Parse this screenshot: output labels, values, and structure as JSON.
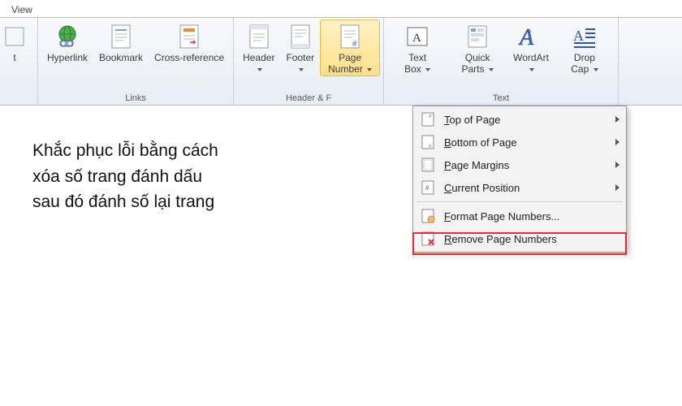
{
  "tab": "View",
  "ribbon": {
    "cut_tail": "t",
    "hyperlink": "Hyperlink",
    "bookmark": "Bookmark",
    "crossref": "Cross-reference",
    "links_group": "Links",
    "header": "Header",
    "footer": "Footer",
    "page_number": "Page\nNumber",
    "hf_group": "Header & F",
    "text_box": "Text\nBox",
    "quick_parts": "Quick\nParts",
    "wordart": "WordArt",
    "drop_cap": "Drop\nCap",
    "text_group": "Text"
  },
  "note_line1": "Khắc phục lỗi bằng cách",
  "note_line2": "xóa số trang đánh dấu",
  "note_line3": "sau đó đánh số lại trang",
  "menu": {
    "top": "Top of Page",
    "bottom": "Bottom of Page",
    "margins": "Page Margins",
    "current": "Current Position",
    "format": "Format Page Numbers...",
    "remove": "Remove Page Numbers"
  },
  "menu_accel": {
    "top": "T",
    "bottom": "B",
    "margins": "P",
    "current": "C",
    "format": "F",
    "remove": "R"
  }
}
